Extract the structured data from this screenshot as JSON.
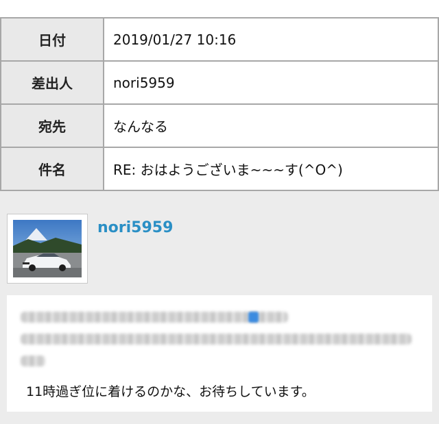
{
  "header": {
    "rows": [
      {
        "label": "日付",
        "value": "2019/01/27 10:16"
      },
      {
        "label": "差出人",
        "value": "nori5959"
      },
      {
        "label": "宛先",
        "value": "なんなる"
      },
      {
        "label": "件名",
        "value": "RE: おはようございま~~~す(^O^)"
      }
    ]
  },
  "message": {
    "sender": "nori5959",
    "visible_text": "11時過ぎ位に着けるのかな、お待ちしています。"
  },
  "colors": {
    "sender_link": "#2a8fc5",
    "label_bg": "#e9e9e9",
    "border": "#a7a7a7",
    "page_bg": "#ececec"
  }
}
